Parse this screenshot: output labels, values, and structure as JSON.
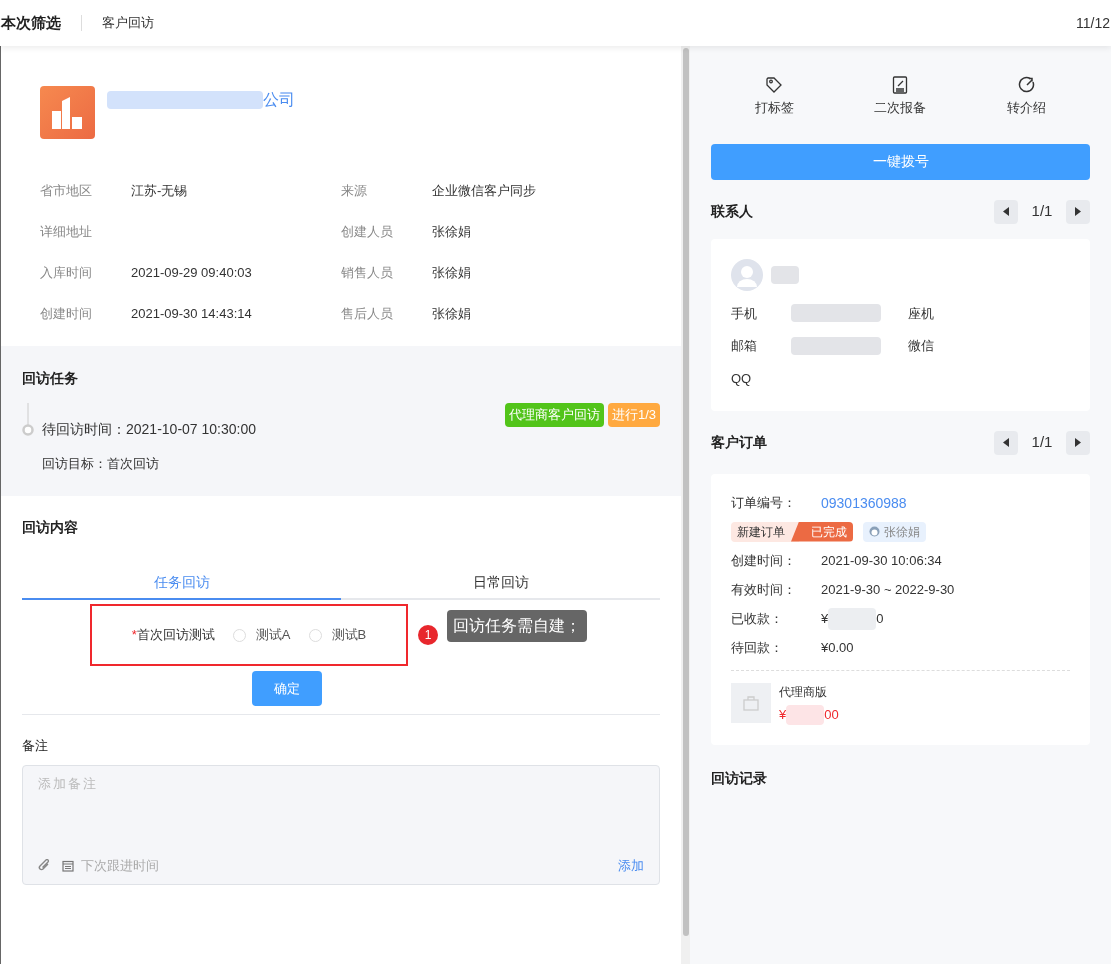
{
  "header": {
    "title": "本次筛选",
    "subtitle": "客户回访",
    "page": "11/12"
  },
  "company": {
    "name_visible": "公司"
  },
  "info_fields": [
    {
      "label": "省市地区",
      "value": "江苏-无锡"
    },
    {
      "label": "来源",
      "value": "企业微信客户同步"
    },
    {
      "label": "详细地址"
    },
    {
      "label": "创建人员",
      "value": "张徐娟"
    },
    {
      "label": "入库时间",
      "value": "2021-09-29 09:40:03"
    },
    {
      "label": "销售人员",
      "value": "张徐娟"
    },
    {
      "label": "创建时间",
      "value": "2021-09-30 14:43:14"
    },
    {
      "label": "售后人员",
      "value": "张徐娟"
    }
  ],
  "task": {
    "title": "回访任务",
    "time": "待回访时间：2021-10-07 10:30:00",
    "goal": "回访目标：首次回访",
    "tags": [
      {
        "text": "代理商客户回访",
        "color": "#52c41a"
      },
      {
        "text": "进行1/3",
        "color": "#ffa940"
      }
    ]
  },
  "content": {
    "title": "回访内容",
    "tabs": [
      {
        "label": "任务回访",
        "selected": true
      },
      {
        "label": "日常回访",
        "selected": false
      }
    ],
    "question": {
      "required_mark": "*",
      "label": "首次回访测试",
      "options": [
        {
          "label": "测试A",
          "selected": false
        },
        {
          "label": "测试B",
          "selected": false
        }
      ]
    },
    "confirm": "确定",
    "annotation": {
      "number": "1",
      "text": "回访任务需自建；"
    }
  },
  "note": {
    "title": "备注",
    "placeholder": "添加备注",
    "next_time": "下次跟进时间",
    "add": "添加"
  },
  "actions": [
    {
      "label": "打标签",
      "kind": "tag"
    },
    {
      "label": "二次报备",
      "kind": "report"
    },
    {
      "label": "转介绍",
      "kind": "refer"
    }
  ],
  "dial": "一键拨号",
  "contacts": {
    "title": "联系人",
    "pager": "1/1",
    "fields": [
      "手机",
      "座机",
      "邮箱",
      "微信",
      "QQ"
    ]
  },
  "orders": {
    "title": "客户订单",
    "pager": "1/1",
    "order_no_label": "订单编号：",
    "order_no": "09301360988",
    "status_left": "新建订单",
    "status_right": "已完成",
    "owner": "张徐娟",
    "rows": [
      {
        "label": "创建时间：",
        "value": "2021-09-30 10:06:34"
      },
      {
        "label": "有效时间：",
        "value": "2021-9-30 ~ 2022-9-30"
      },
      {
        "label": "已收款：",
        "value_start": "¥",
        "value_end": "0"
      },
      {
        "label": "待回款：",
        "value": "¥0.00"
      }
    ],
    "product": {
      "name": "代理商版",
      "price_start": "¥",
      "price_end": "00"
    }
  },
  "records": {
    "title": "回访记录"
  }
}
